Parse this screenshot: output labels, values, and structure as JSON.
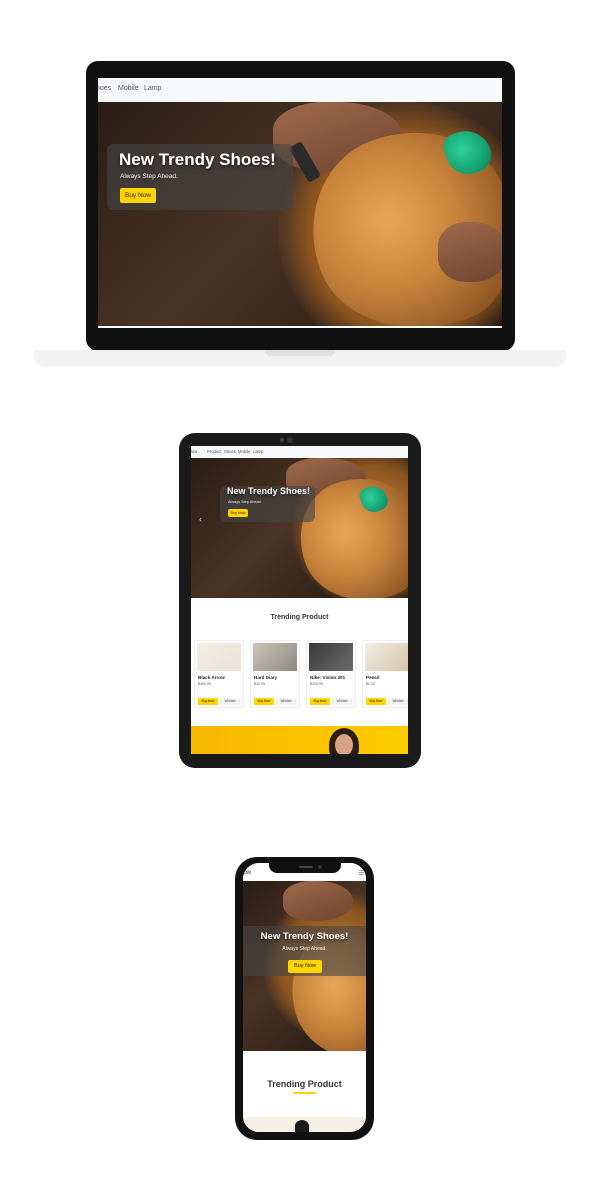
{
  "nav": {
    "items": [
      "Home",
      "Product",
      "Shoes",
      "Mobile",
      "Lamp"
    ],
    "visible_laptop": "hoes",
    "brand_fragment": "low"
  },
  "hero": {
    "title": "New Trendy Shoes!",
    "subtitle": "Always Step Ahead.",
    "cta": "Buy Now"
  },
  "trending": {
    "title": "Trending Product",
    "products": [
      {
        "name": "Black Arrow",
        "price": "$400.99"
      },
      {
        "name": "Hard Diary",
        "price": "$20.99"
      },
      {
        "name": "Nike: Vision 201",
        "price": "$200.99"
      },
      {
        "name": "Pencil",
        "price": "$2.22"
      }
    ],
    "buy_label": "Buy Now",
    "wishlist_label": "Wishlist"
  },
  "colors": {
    "accent": "#ffd400",
    "device_frame": "#111111",
    "hero_dark": "#2a1d14"
  },
  "icons": {
    "prev": "chevron-left-icon",
    "menu": "hamburger-icon"
  }
}
